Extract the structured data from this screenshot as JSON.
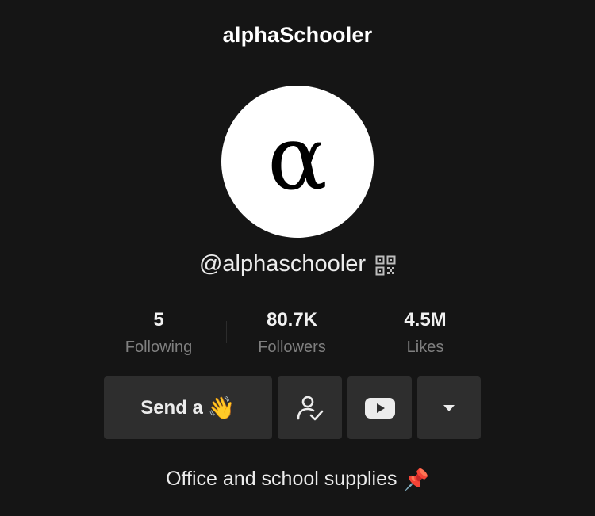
{
  "header": {
    "title": "alphaSchooler"
  },
  "profile": {
    "avatar_glyph": "α",
    "handle": "@alphaschooler"
  },
  "stats": [
    {
      "value": "5",
      "label": "Following"
    },
    {
      "value": "80.7K",
      "label": "Followers"
    },
    {
      "value": "4.5M",
      "label": "Likes"
    }
  ],
  "actions": {
    "send_label": "Send a",
    "send_emoji": "👋"
  },
  "bio": {
    "text": "Office and school supplies",
    "emoji": "📌"
  },
  "colors": {
    "background": "#151515",
    "button": "#2e2e2e",
    "muted_text": "#7f7f7f",
    "pin_red": "#d83b3b"
  },
  "icons": [
    "qr-code-icon",
    "follow-check-icon",
    "youtube-icon",
    "caret-down-icon"
  ]
}
